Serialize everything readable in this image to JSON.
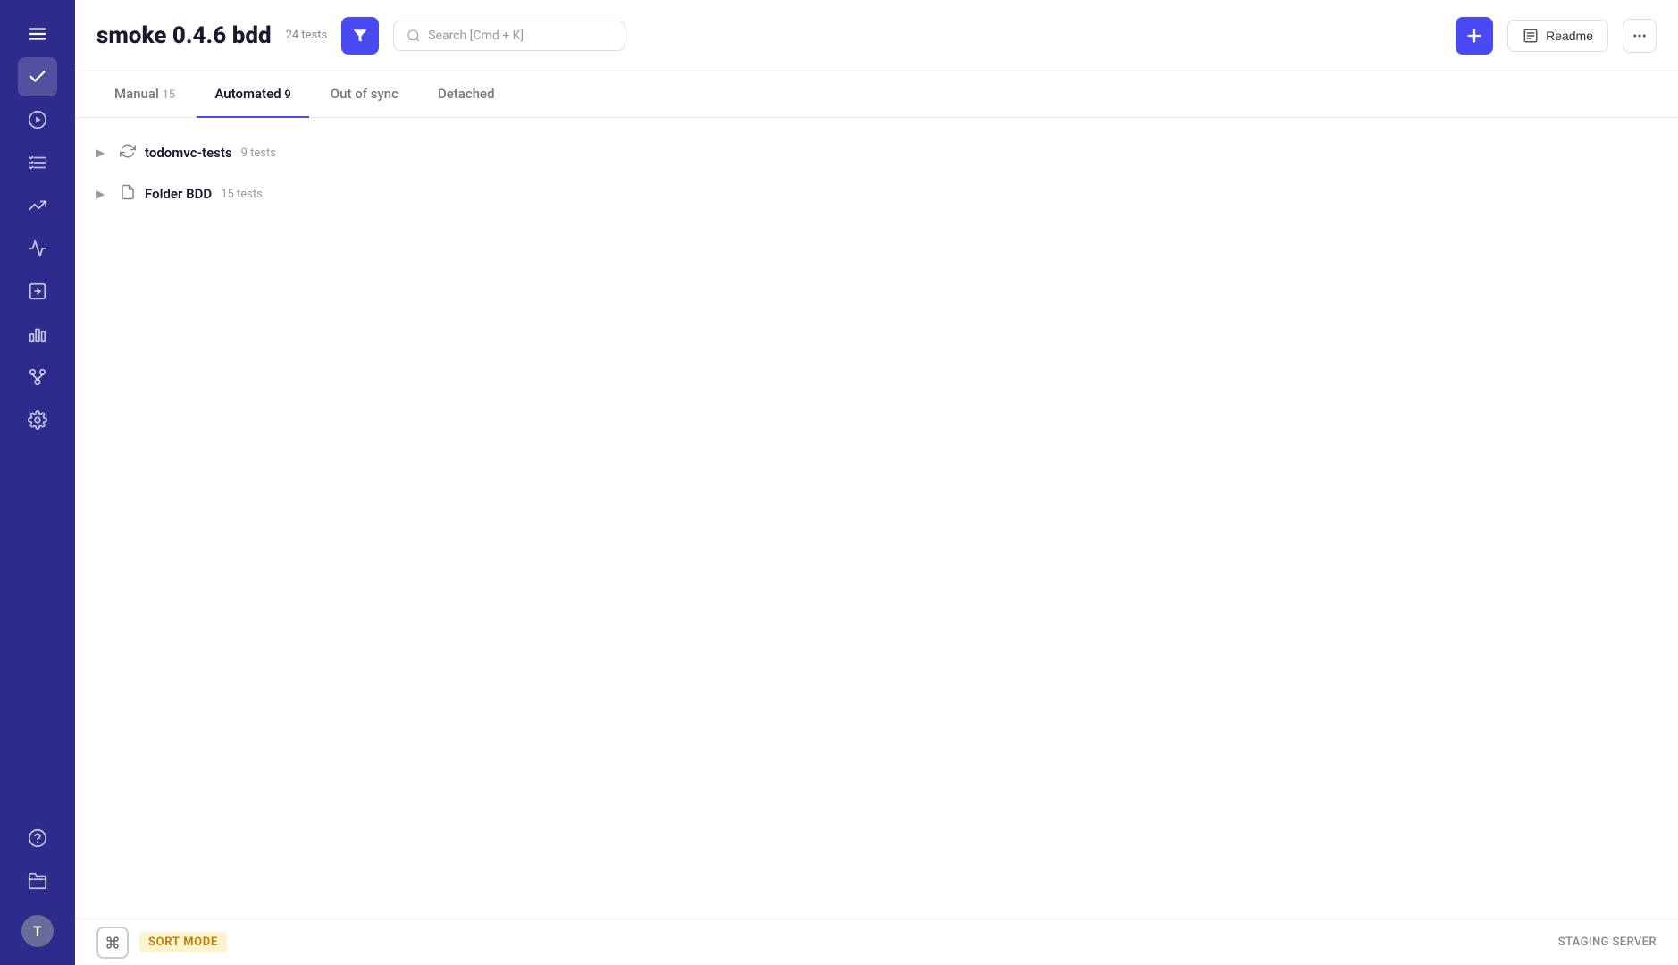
{
  "sidebar": {
    "items": [
      {
        "name": "menu",
        "icon": "☰",
        "active": false
      },
      {
        "name": "check",
        "icon": "✓",
        "active": true
      },
      {
        "name": "play",
        "icon": "▷",
        "active": false
      },
      {
        "name": "list-check",
        "icon": "≡✓",
        "active": false
      },
      {
        "name": "trend",
        "icon": "⤴",
        "active": false
      },
      {
        "name": "activity",
        "icon": "⚡",
        "active": false
      },
      {
        "name": "import",
        "icon": "⇥",
        "active": false
      },
      {
        "name": "bar-chart",
        "icon": "▦",
        "active": false
      },
      {
        "name": "fork",
        "icon": "⑂",
        "active": false
      },
      {
        "name": "settings",
        "icon": "⚙",
        "active": false
      },
      {
        "name": "help",
        "icon": "?",
        "active": false
      },
      {
        "name": "folders",
        "icon": "🗂",
        "active": false
      }
    ],
    "avatar_label": "T"
  },
  "header": {
    "title": "smoke 0.4.6 bdd",
    "tests_count": "24 tests",
    "filter_label": "filter",
    "search_placeholder": "Search [Cmd + K]",
    "add_label": "+",
    "readme_label": "Readme",
    "more_label": "..."
  },
  "tabs": [
    {
      "id": "manual",
      "label": "Manual",
      "count": "15",
      "active": false
    },
    {
      "id": "automated",
      "label": "Automated",
      "count": "9",
      "active": true
    },
    {
      "id": "out-of-sync",
      "label": "Out of sync",
      "count": "",
      "active": false
    },
    {
      "id": "detached",
      "label": "Detached",
      "count": "",
      "active": false
    }
  ],
  "folders": [
    {
      "name": "todomvc-tests",
      "count": "9 tests",
      "icon": "sync"
    },
    {
      "name": "Folder BDD",
      "count": "15 tests",
      "icon": "doc"
    }
  ],
  "footer": {
    "sort_mode_label": "SORT MODE",
    "staging_label": "STAGING SERVER"
  }
}
